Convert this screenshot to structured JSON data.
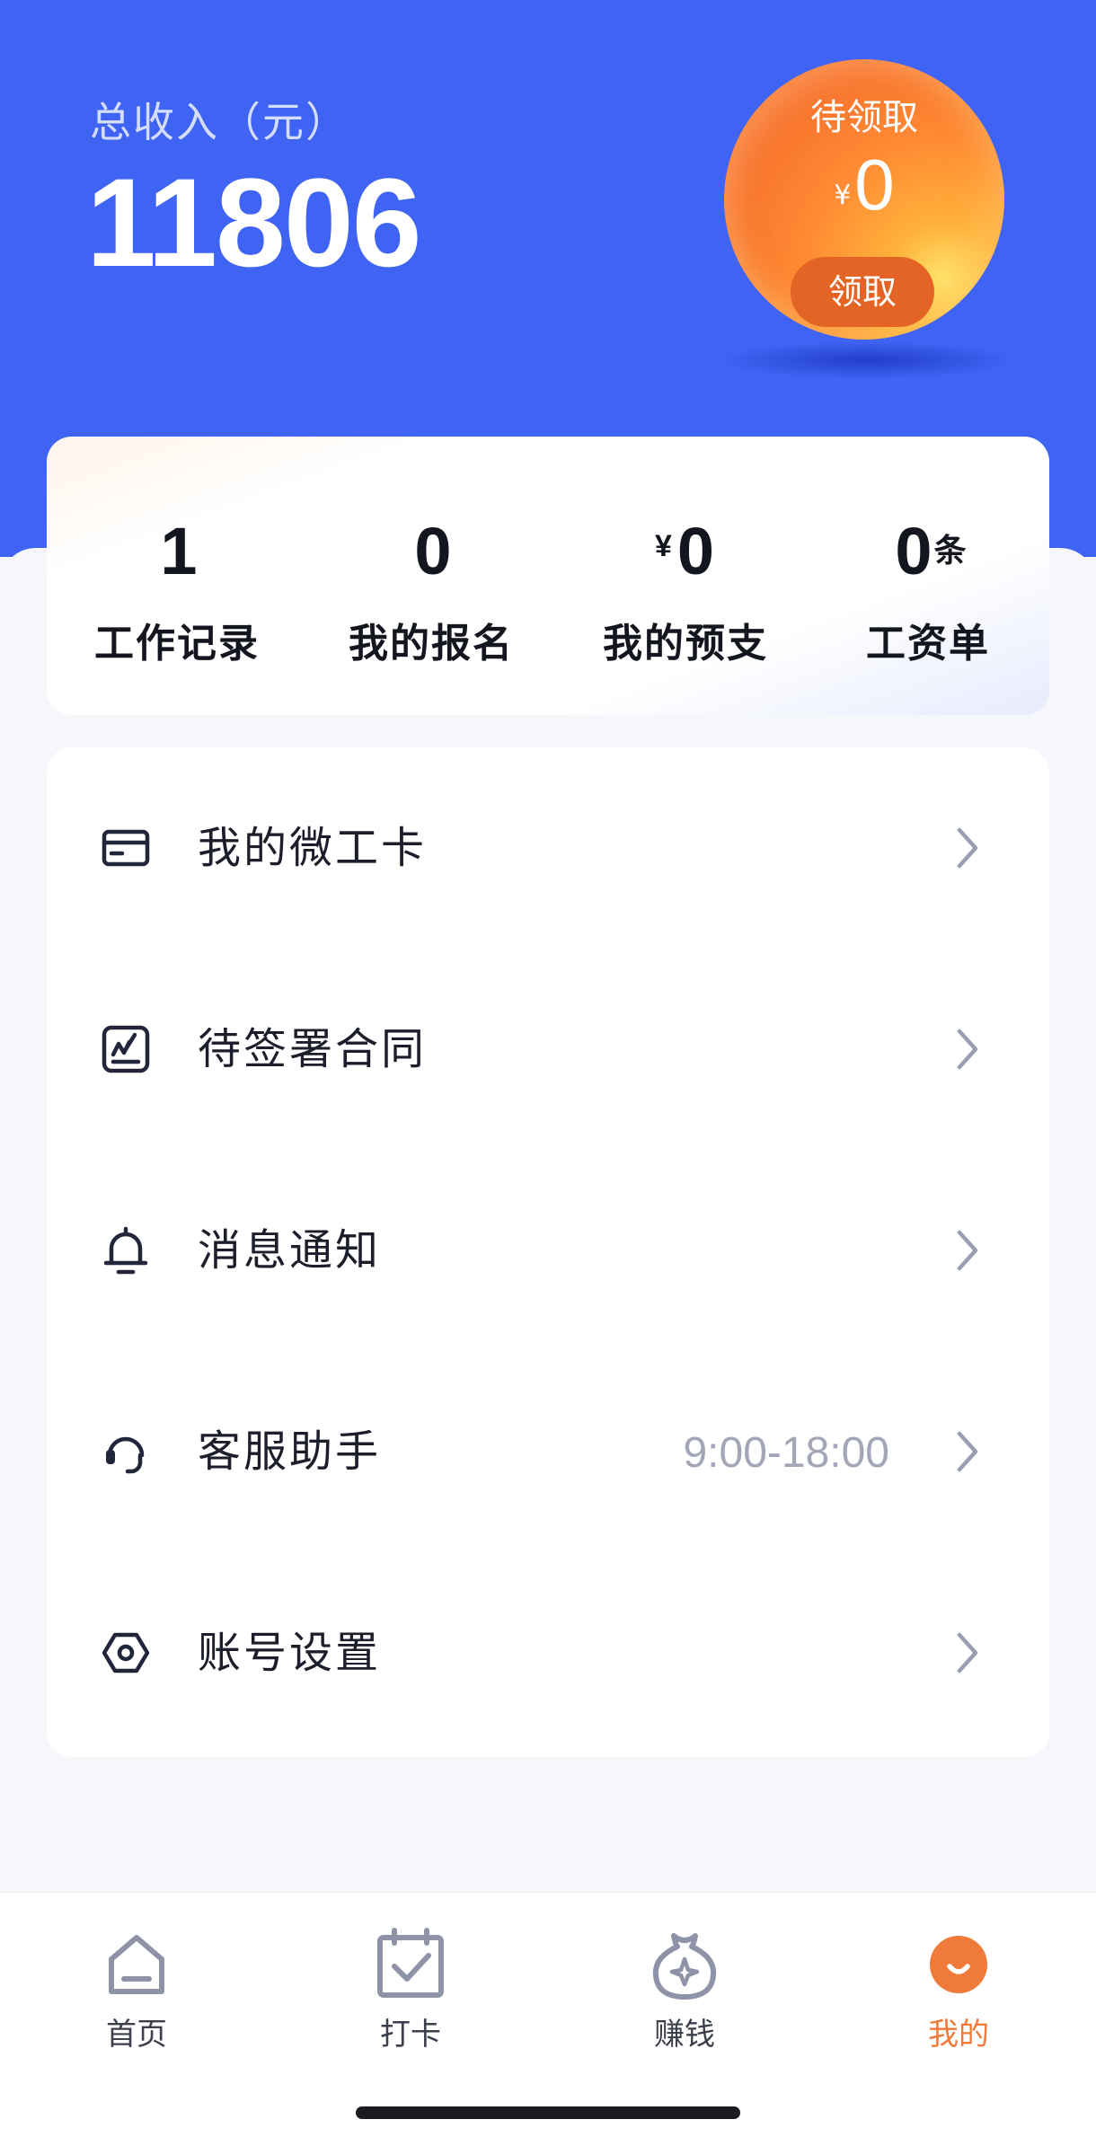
{
  "header": {
    "income_label": "总收入（元）",
    "income_value": "11806"
  },
  "reward_orb": {
    "title": "待领取",
    "currency": "¥",
    "amount": "0",
    "button_label": "领取"
  },
  "stats": [
    {
      "prefix": "",
      "value": "1",
      "suffix": "",
      "label": "工作记录"
    },
    {
      "prefix": "",
      "value": "0",
      "suffix": "",
      "label": "我的报名"
    },
    {
      "prefix": "¥",
      "value": "0",
      "suffix": "",
      "label": "我的预支"
    },
    {
      "prefix": "",
      "value": "0",
      "suffix": "条",
      "label": "工资单"
    }
  ],
  "menu": [
    {
      "label": "我的微工卡",
      "icon": "card-icon",
      "extra": ""
    },
    {
      "label": "待签署合同",
      "icon": "signature-icon",
      "extra": ""
    },
    {
      "label": "消息通知",
      "icon": "bell-icon",
      "extra": ""
    },
    {
      "label": "客服助手",
      "icon": "headset-icon",
      "extra": "9:00-18:00"
    },
    {
      "label": "账号设置",
      "icon": "settings-icon",
      "extra": ""
    }
  ],
  "tabbar": {
    "items": [
      {
        "label": "首页",
        "icon": "home-icon"
      },
      {
        "label": "打卡",
        "icon": "checkin-calendar-icon"
      },
      {
        "label": "赚钱",
        "icon": "money-bag-icon"
      },
      {
        "label": "我的",
        "icon": "profile-face-icon"
      }
    ],
    "active_index": 3
  },
  "colors": {
    "header_blue": "#3f63f3",
    "accent_orange": "#ef7a3a",
    "orb_button": "#e46425",
    "muted_text": "#a3a6b7"
  }
}
